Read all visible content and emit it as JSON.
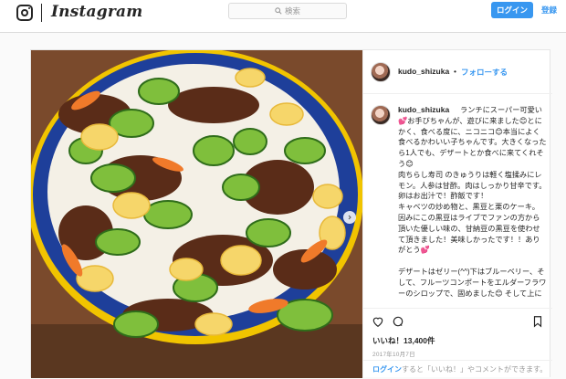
{
  "header": {
    "brand": "Instagram",
    "search_placeholder": "検索",
    "login_label": "ログイン",
    "signup_label": "登録",
    "icons": [
      "instagram-glyph-icon",
      "search-icon"
    ]
  },
  "post": {
    "username": "kudo_shizuka",
    "separator": "•",
    "follow_label": "フォローする",
    "caption": "ランチにスーパー可愛い💕お手びちゃんが、遊びに来ました😊とにかく、食べる度に、ニコニコ😊本当によく食べるかわいい子ちゃんです。大きくなったら1人でも、デザートとか食べに来てくれそう😊\n肉ちらし寿司 のきゅうりは軽く塩揉みにレモン。人参は甘酢。肉はしっかり甘辛です。卵はお出汁で！酢飯です！\nキャベツの炒め物と、黒豆と栗のケーキ。因みにこの黒豆はライブでファンの方から頂いた優しい味の、甘納豆の黒豆を使わせて頂きました！美味しかったです！！ありがとう💕\n\nデザートはゼリー(^^)下はブルーベリー、そして、フルーツコンポートをエルダーフラワーのシロップで、固めました😊 そして上に葡萄。マスカットも乗せてみたかな。",
    "likes": "いいね！13,400件",
    "date": "2017年10月7日",
    "login_prompt_link": "ログイン",
    "login_prompt_rest": "すると「いいね！」やコメントができます。",
    "icons": [
      "heart-icon",
      "comment-icon",
      "bookmark-icon",
      "chevron-right-icon"
    ]
  }
}
